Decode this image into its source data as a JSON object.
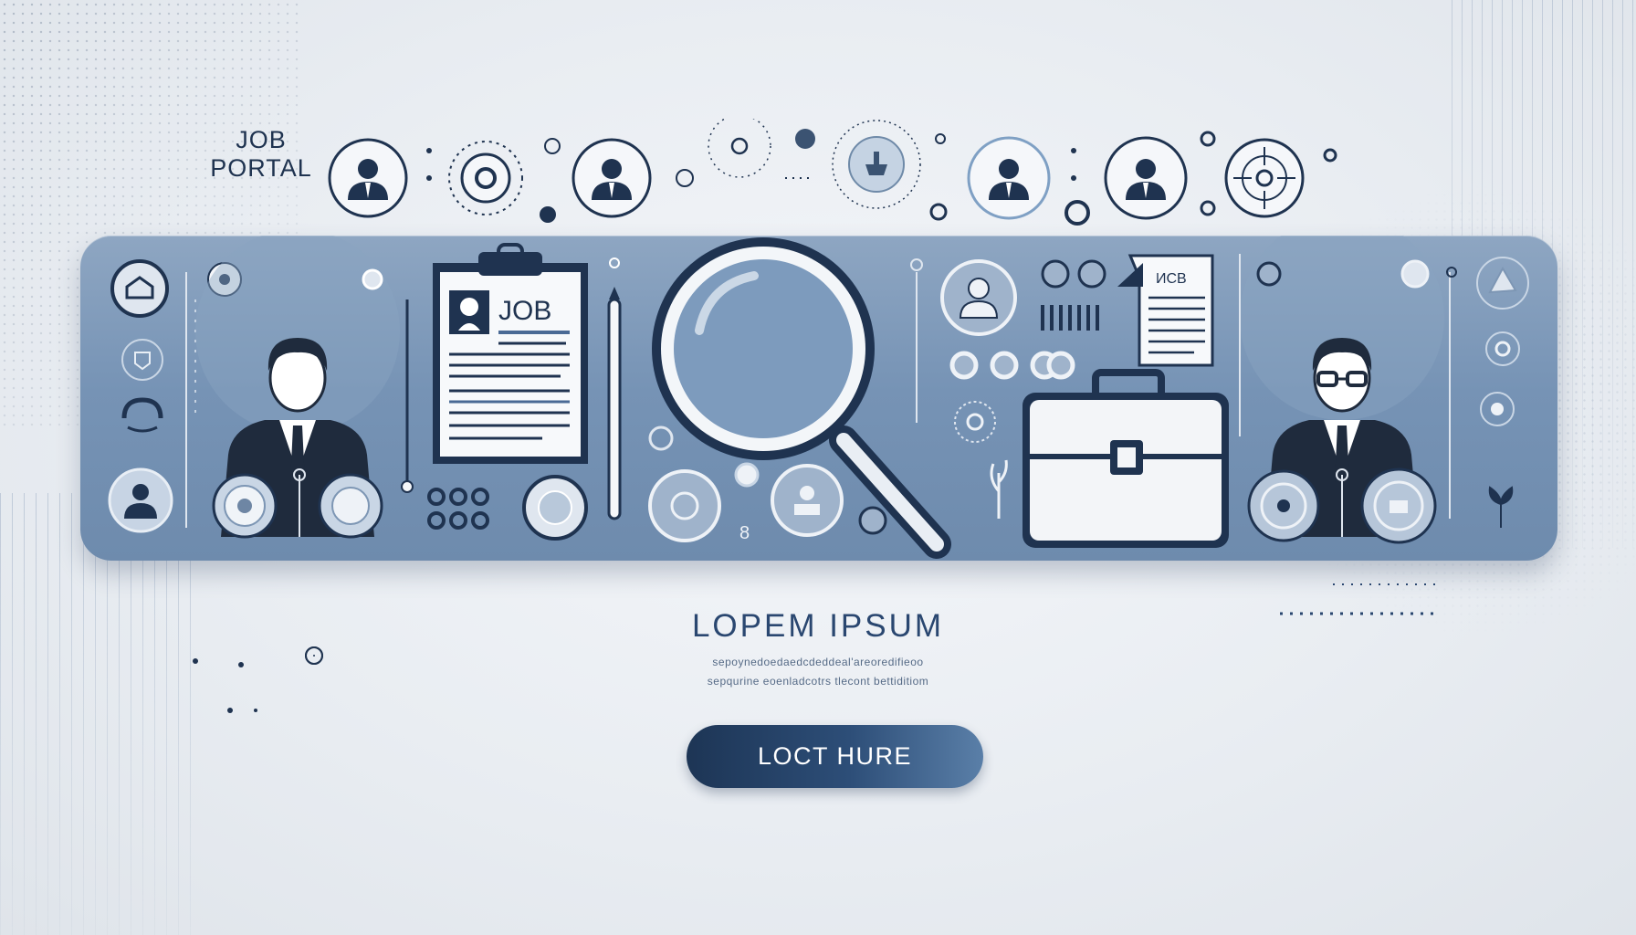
{
  "logo": {
    "line1": "JOB",
    "line2": "PORTAL"
  },
  "banner": {
    "clipboard_label": "JOB",
    "doc_label": "ИCB"
  },
  "hero": {
    "headline": "LOPEM IPSUM",
    "subline1": "sepoynedoedaedcdeddeal'areoredifieoo",
    "subline2": "sepqurine eoenladcotrs tlecont bettiditiom"
  },
  "cta": {
    "label": "LOCT HURE"
  },
  "icons": {
    "person": "person-icon",
    "search": "magnifier-icon",
    "document": "document-icon",
    "briefcase": "briefcase-icon",
    "target": "target-icon"
  },
  "colors": {
    "banner": "#7693b5",
    "navy": "#1f3350",
    "button": "#1d3555",
    "background": "#eceff3"
  }
}
